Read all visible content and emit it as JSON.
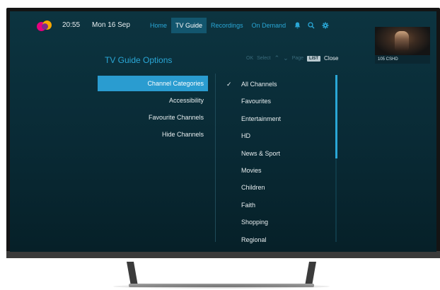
{
  "header": {
    "time": "20:55",
    "date": "Mon 16 Sep",
    "tabs": [
      {
        "label": "Home"
      },
      {
        "label": "TV Guide"
      },
      {
        "label": "Recordings"
      },
      {
        "label": "On Demand"
      }
    ],
    "active_tab": "TV Guide",
    "icons": [
      "notification-bell-icon",
      "search-icon",
      "settings-gear-icon"
    ]
  },
  "preview": {
    "channel_label": "105 CSHD"
  },
  "panel": {
    "title": "TV Guide Options",
    "hints": {
      "ok_key": "OK",
      "select_label": "Select",
      "page_label": "Page",
      "list_key": "LIST",
      "close_label": "Close"
    },
    "left_menu": [
      {
        "label": "Channel Categories"
      },
      {
        "label": "Accessibility"
      },
      {
        "label": "Favourite Channels"
      },
      {
        "label": "Hide Channels"
      }
    ],
    "selected_left": "Channel Categories",
    "categories": [
      {
        "label": "All Channels",
        "checked": true
      },
      {
        "label": "Favourites",
        "checked": false
      },
      {
        "label": "Entertainment",
        "checked": false
      },
      {
        "label": "HD",
        "checked": false
      },
      {
        "label": "News & Sport",
        "checked": false
      },
      {
        "label": "Movies",
        "checked": false
      },
      {
        "label": "Children",
        "checked": false
      },
      {
        "label": "Faith",
        "checked": false
      },
      {
        "label": "Shopping",
        "checked": false
      },
      {
        "label": "Regional",
        "checked": false
      }
    ],
    "scroll_visible_fraction": 0.5
  },
  "colors": {
    "accent": "#2aa7d6",
    "selected_bg": "#2a9cd0",
    "screen_bg": "#0a2f3a",
    "logo_pink": "#e6007e",
    "logo_orange": "#f7a600",
    "logo_purple": "#7d2b8b"
  }
}
